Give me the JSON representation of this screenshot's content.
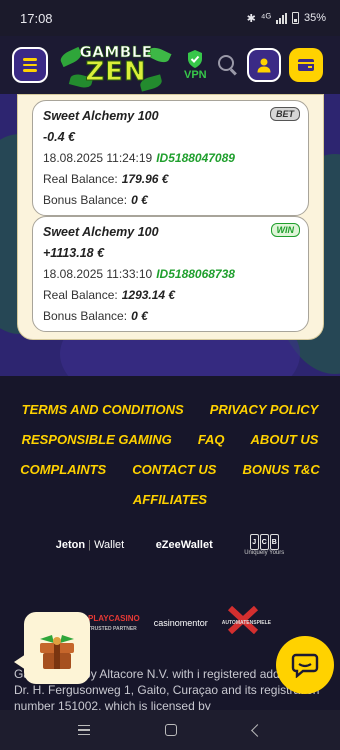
{
  "status_bar": {
    "time": "17:08",
    "signal": "⁴ᴳ",
    "battery": "35%"
  },
  "header": {
    "logo_line1": "GAMBLE",
    "logo_line2": "ZEN",
    "vpn_label": "VPN"
  },
  "transactions": [
    {
      "game": "Sweet Alchemy 100",
      "amount": "-0.4 €",
      "datetime": "18.08.2025 11:24:19",
      "id": "ID5188047089",
      "real_label": "Real Balance:",
      "real_value": "179.96 €",
      "bonus_label": "Bonus Balance:",
      "bonus_value": "0 €",
      "badge": "BET"
    },
    {
      "game": "Sweet Alchemy 100",
      "amount": "+1113.18 €",
      "datetime": "18.08.2025 11:33:10",
      "id": "ID5188068738",
      "real_label": "Real Balance:",
      "real_value": "1293.14 €",
      "bonus_label": "Bonus Balance:",
      "bonus_value": "0 €",
      "badge": "WIN"
    }
  ],
  "footer": {
    "links": {
      "terms": "TERMS AND CONDITIONS",
      "privacy": "PRIVACY POLICY",
      "responsible": "RESPONSIBLE GAMING",
      "faq": "FAQ",
      "about": "ABOUT US",
      "complaints": "COMPLAINTS",
      "contact": "CONTACT US",
      "bonus_tc": "BONUS T&C",
      "affiliates": "AFFILIATES"
    },
    "payments": {
      "jeton": "Jeton",
      "jeton_suffix": "Wallet",
      "ezee": "eZeeWallet",
      "jcb_tagline": "Uniquely Yours"
    },
    "partners": {
      "playcasino": "PLAYCASINO",
      "playcasino_sub": "TRUSTED PARTNER",
      "casinomentor": "casinomentor",
      "automaten": "AUTOMATENSPIELE"
    },
    "legal_text": "Ga                       operated by Altacore N.V. with i registered address at Dr. H. Fergusonweg 1, Gaito, Curaçao and its registration number 151002, which is licensed by"
  },
  "colors": {
    "accent": "#ffd200",
    "brand_purple": "#3b2a86",
    "win_green": "#1f9f2d",
    "background": "#17162a"
  }
}
